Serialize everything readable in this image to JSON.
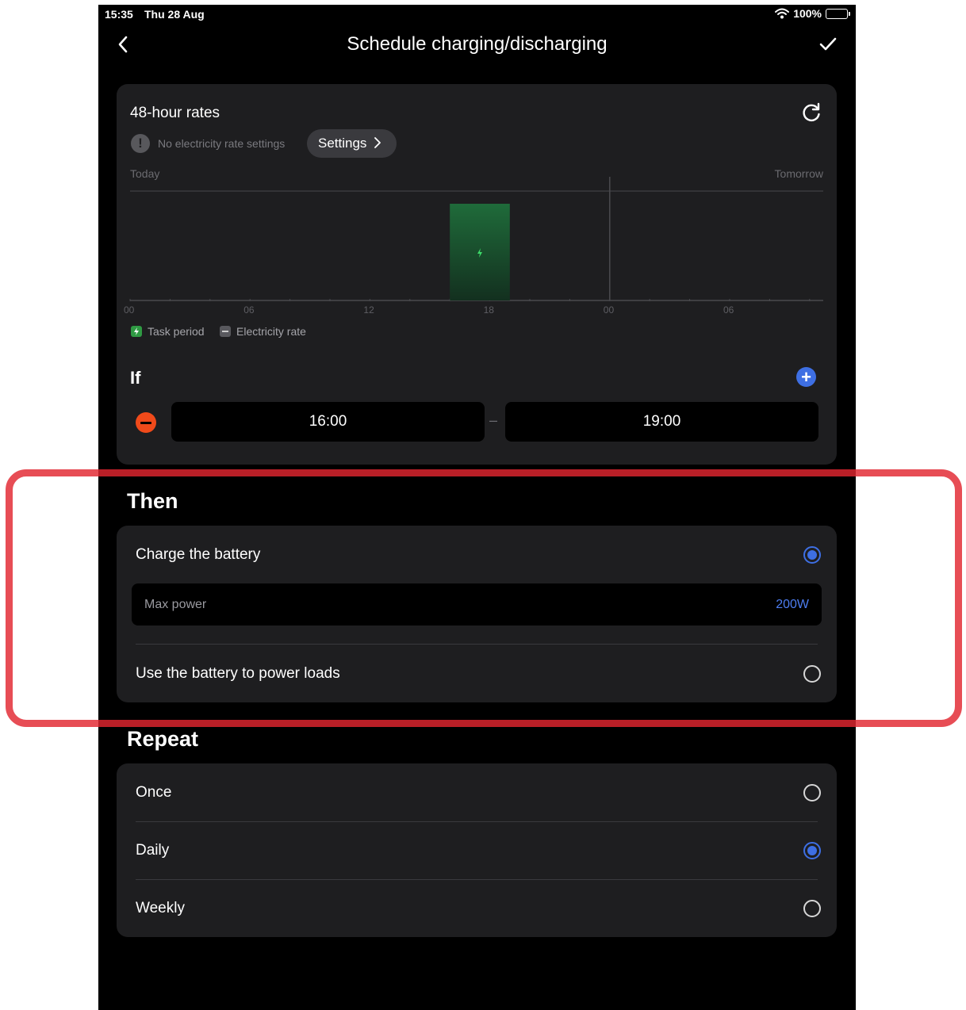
{
  "status_bar": {
    "time": "15:35",
    "date": "Thu 28 Aug",
    "battery": "100%"
  },
  "nav": {
    "title": "Schedule charging/discharging"
  },
  "rates": {
    "title": "48-hour rates",
    "warning": "No electricity rate settings",
    "settings_label": "Settings",
    "today_label": "Today",
    "tomorrow_label": "Tomorrow"
  },
  "chart_data": {
    "type": "bar",
    "x_ticks": [
      "00",
      "06",
      "12",
      "18",
      "00",
      "06"
    ],
    "x_range_hours": [
      0,
      42
    ],
    "divider_hour": 24,
    "task_period": {
      "start_hour": 16,
      "end_hour": 19
    },
    "legend": [
      "Task period",
      "Electricity rate"
    ]
  },
  "if_section": {
    "title": "If",
    "start_time": "16:00",
    "separator": "–",
    "end_time": "19:00"
  },
  "then_section": {
    "title": "Then",
    "option_charge": "Charge the battery",
    "max_power_label": "Max power",
    "max_power_value": "200W",
    "option_discharge": "Use the battery to power loads",
    "selected": "charge"
  },
  "repeat_section": {
    "title": "Repeat",
    "options": [
      "Once",
      "Daily",
      "Weekly"
    ],
    "selected": "Daily"
  },
  "colors": {
    "accent_blue": "#3e6fe3",
    "task_green": "#2f9a43",
    "remove_red": "#f04a1a",
    "highlight_red": "#e22630"
  }
}
